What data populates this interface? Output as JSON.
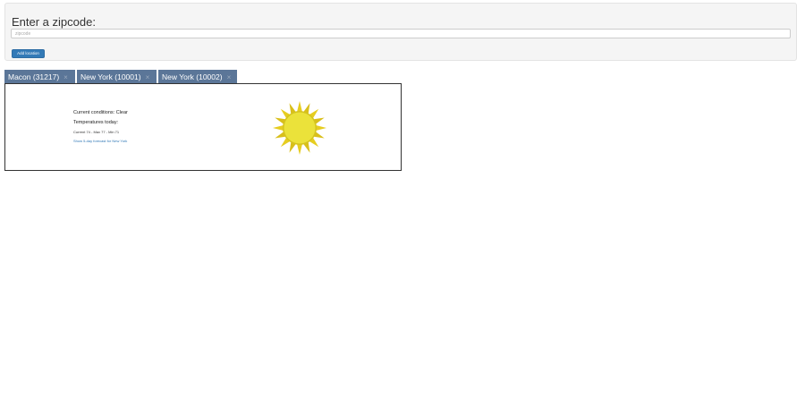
{
  "search": {
    "title": "Enter a zipcode:",
    "placeholder": "zipcode",
    "value": "",
    "add_label": "Add location"
  },
  "tabs": [
    {
      "label": "Macon (31217)",
      "close": "×"
    },
    {
      "label": "New York (10001)",
      "close": "×"
    },
    {
      "label": "New York (10002)",
      "close": "×"
    }
  ],
  "weather": {
    "conditions": "Current conditions: Clear",
    "temps_label": "Temperatures today:",
    "temps": "Current 74 - Max 77 - Min 71",
    "forecast_link": "Show 5-day forecast for New York",
    "icon": "sun-icon",
    "colors": {
      "sun_core": "#ebe23a",
      "sun_rays": "#e3c91f",
      "tab_bg": "#5b7698",
      "button_bg": "#337ab7"
    }
  }
}
